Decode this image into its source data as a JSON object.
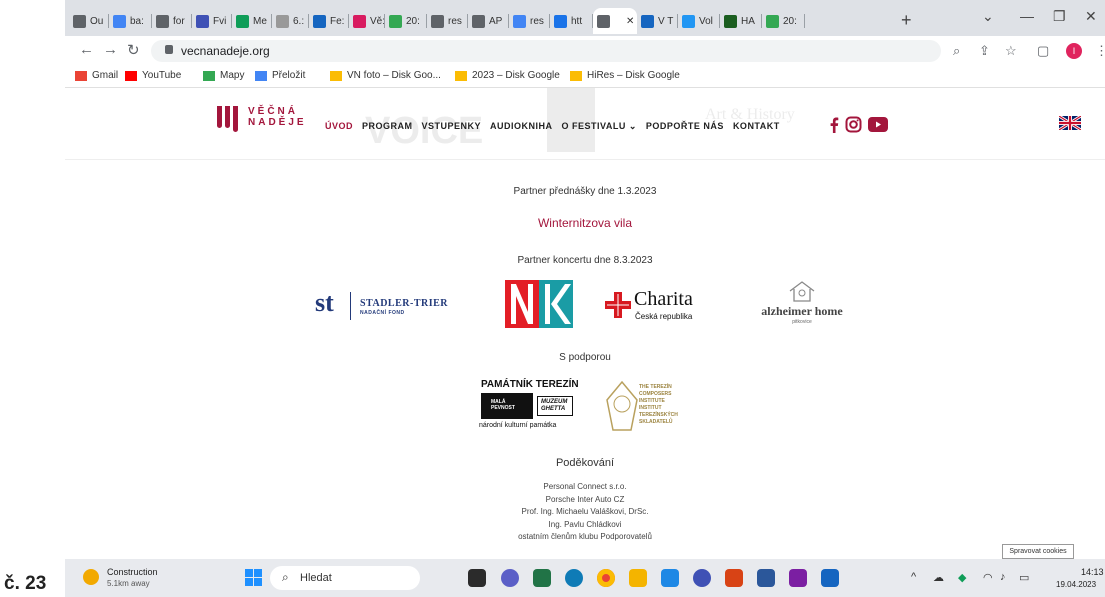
{
  "caption": "č. 23",
  "browser": {
    "tabs": [
      {
        "label": "Ou",
        "color": "#5f6368"
      },
      {
        "label": "ba:",
        "color": "#4285f4"
      },
      {
        "label": "for",
        "color": "#5f6368"
      },
      {
        "label": "Fvi",
        "color": "#3f51b5"
      },
      {
        "label": "Me",
        "color": "#0f9d58"
      },
      {
        "label": "6.:",
        "color": "#999999"
      },
      {
        "label": "Fe:",
        "color": "#1565c0"
      },
      {
        "label": "Vě:",
        "color": "#d81b60"
      },
      {
        "label": "20:",
        "color": "#34a853"
      },
      {
        "label": "res",
        "color": "#5f6368"
      },
      {
        "label": "AP",
        "color": "#5f6368"
      },
      {
        "label": "res",
        "color": "#4285f4"
      },
      {
        "label": "htt",
        "color": "#1a73e8"
      },
      {
        "label": "",
        "color": "#5f6368"
      },
      {
        "label": "V T",
        "color": "#1565c0"
      },
      {
        "label": "Vol",
        "color": "#2196f3"
      },
      {
        "label": "HA",
        "color": "#1b5e20"
      },
      {
        "label": "20:",
        "color": "#34a853"
      }
    ],
    "url": "vecnanadeje.org",
    "bookmarks": [
      {
        "label": "Gmail",
        "color": "#ea4335"
      },
      {
        "label": "YouTube",
        "color": "#ff0000"
      },
      {
        "label": "Mapy",
        "color": "#34a853"
      },
      {
        "label": "Přeložit",
        "color": "#4285f4"
      },
      {
        "label": "VN foto – Disk Goo...",
        "color": "#fbbc04"
      },
      {
        "label": "2023 – Disk Google",
        "color": "#fbbc04"
      },
      {
        "label": "HiRes – Disk Google",
        "color": "#fbbc04"
      }
    ]
  },
  "site": {
    "brand_line1": "VĚČNÁ",
    "brand_line2": "NADĚJE",
    "bg_words": [
      "VOICE",
      "Art & History"
    ],
    "nav": [
      "ÚVOD",
      "PROGRAM",
      "VSTUPENKY",
      "AUDIOKNIHA",
      "O FESTIVALU ⌄",
      "PODPOŘTE NÁS",
      "KONTAKT"
    ],
    "lecture_partner_heading": "Partner přednášky dne 1.3.2023",
    "lecture_partner": "Winternitzova vila",
    "concert_partner_heading": "Partner koncertu dne 8.3.2023",
    "logos": {
      "stadler_mark": "st",
      "stadler_name": "STADLER-TRIER",
      "stadler_sub": "NADAČNÍ FOND",
      "charita_name": "Charita",
      "charita_sub": "Česká republika",
      "alz_name": "alzheimer home",
      "alz_sub": "pitkovice",
      "pt_title": "PAMÁTNÍK TEREZÍN",
      "pt_small1": "MALÁ",
      "pt_small2": "PEVNOST",
      "pt_muzeum": "MUZEUM",
      "pt_ghetta": "GHETTA",
      "pt_sub": "národní kulturní památka",
      "tci_lines": [
        "THE TEREZÍN",
        "COMPOSERS",
        "INSTITUTE",
        "INSTITUT",
        "TEREZÍNSKÝCH",
        "SKLADATELŮ"
      ]
    },
    "support_heading": "S podporou",
    "thanks_heading": "Poděkování",
    "thanks": [
      "Personal Connect s.r.o.",
      "Porsche Inter Auto CZ",
      "Prof. Ing. Michaelu Valáškovi, DrSc.",
      "Ing. Pavlu Chládkovi",
      "ostatním členům klubu Podporovatelů"
    ],
    "cookie_tooltip": "Spravovat cookies"
  },
  "taskbar": {
    "weather_title": "Construction",
    "weather_sub": "5.1km away",
    "search_label": "Hledat",
    "time": "14:13",
    "date": "19.04.2023"
  }
}
